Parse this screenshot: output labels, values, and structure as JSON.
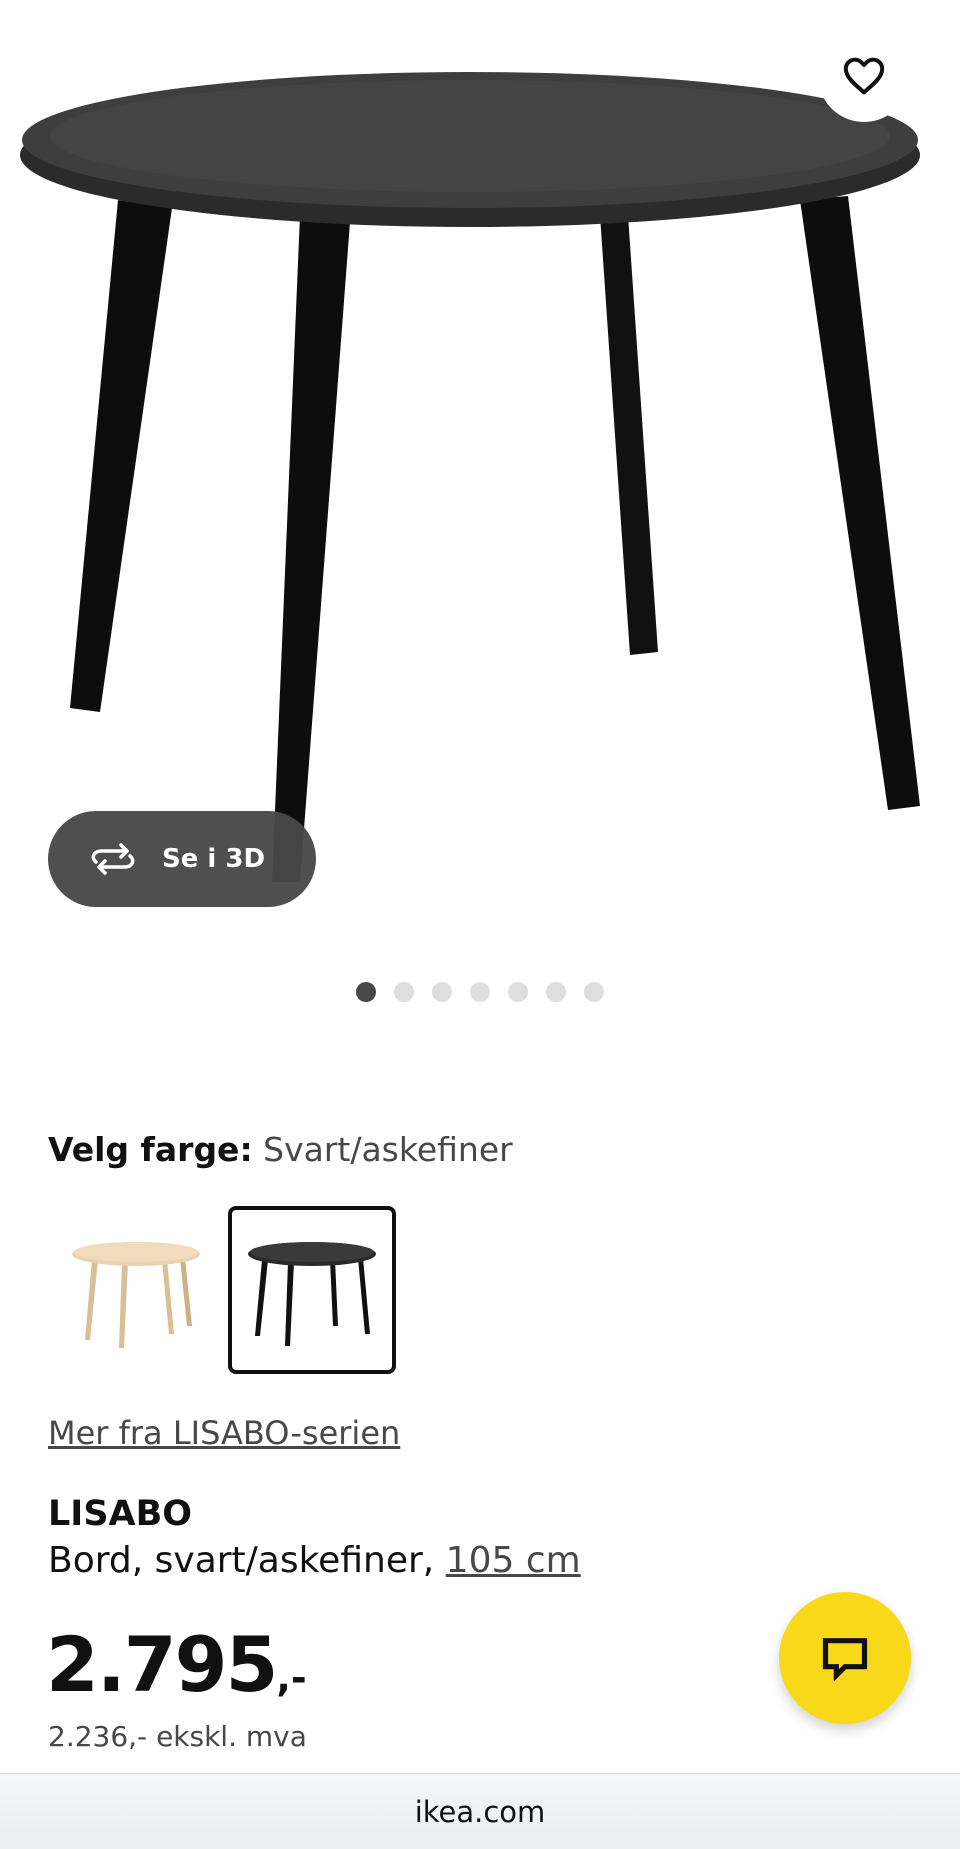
{
  "product_image": {
    "icon": "table-product-image"
  },
  "favorite": {
    "icon": "heart-icon"
  },
  "view_3d": {
    "label": "Se i 3D",
    "icon": "rotate-3d-icon"
  },
  "carousel": {
    "count": 7,
    "active_index": 0
  },
  "color_selector": {
    "label": "Velg farge:",
    "value": "Svart/askefiner",
    "options": [
      {
        "name": "birch",
        "selected": false,
        "color": "#e8d2b0"
      },
      {
        "name": "black",
        "selected": true,
        "color": "#2a2a2a"
      }
    ]
  },
  "series_link": "Mer fra LISABO-serien",
  "product": {
    "name": "LISABO",
    "description": "Bord, svart/askefiner,",
    "size": "105 cm"
  },
  "price": {
    "main": "2.795",
    "suffix": ",-",
    "ex_vat": "2.236,- ekskl. mva"
  },
  "chat": {
    "icon": "chat-bubble-icon",
    "color": "#f8d91a"
  },
  "browser": {
    "url": "ikea.com"
  }
}
